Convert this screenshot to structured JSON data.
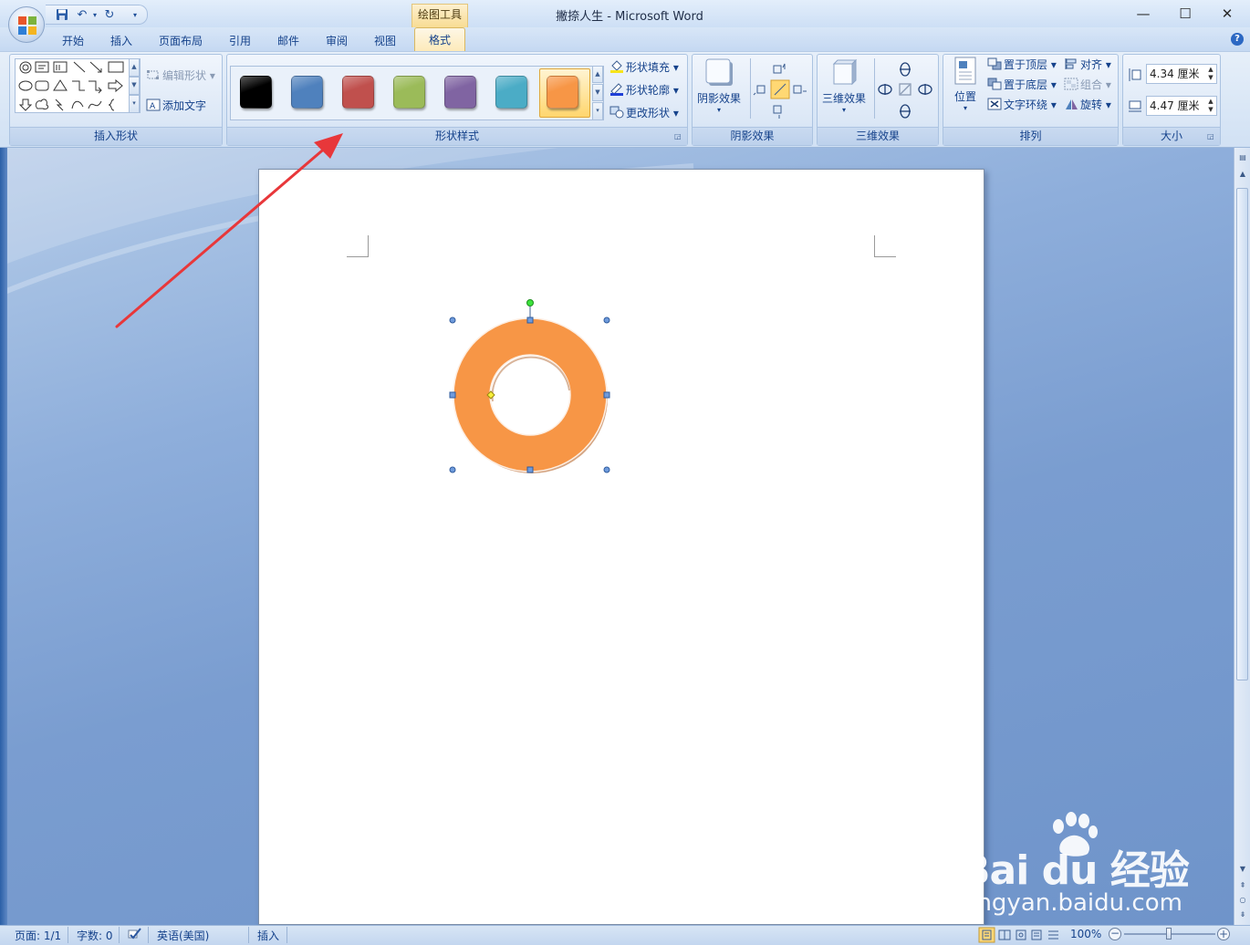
{
  "window": {
    "title": "撇捺人生 - Microsoft Word",
    "context_tab": "绘图工具"
  },
  "tabs": [
    "开始",
    "插入",
    "页面布局",
    "引用",
    "邮件",
    "审阅",
    "视图",
    "格式"
  ],
  "ribbon": {
    "insert_shapes": {
      "label": "插入形状",
      "edit_shape": "编辑形状",
      "add_text": "添加文字"
    },
    "shape_styles": {
      "label": "形状样式",
      "swatch_colors": [
        "#000000",
        "#4f81bd",
        "#c0504d",
        "#9bbb59",
        "#8064a2",
        "#4bacc6",
        "#f79646"
      ],
      "selected_index": 6,
      "fill": "形状填充",
      "outline": "形状轮廓",
      "change_shape": "更改形状"
    },
    "shadow": {
      "label": "阴影效果",
      "button": "阴影效果"
    },
    "three_d": {
      "label": "三维效果",
      "button": "三维效果"
    },
    "arrange": {
      "label": "排列",
      "position": "位置",
      "bring_to_front": "置于顶层",
      "send_to_back": "置于底层",
      "text_wrap": "文字环绕",
      "align": "对齐",
      "group": "组合",
      "rotate": "旋转"
    },
    "size": {
      "label": "大小",
      "height": "4.34 厘米",
      "width": "4.47 厘米"
    }
  },
  "document": {
    "shape": {
      "type": "donut",
      "fill": "#f79646"
    }
  },
  "status": {
    "page": "页面: 1/1",
    "words": "字数: 0",
    "language": "英语(美国)",
    "mode": "插入",
    "zoom": "100%"
  },
  "watermark": {
    "brand": "Bai du 经验",
    "url": "jingyan.baidu.com"
  },
  "colors": {
    "accent_orange": "#f79646",
    "annotation_red": "#e8373a"
  }
}
